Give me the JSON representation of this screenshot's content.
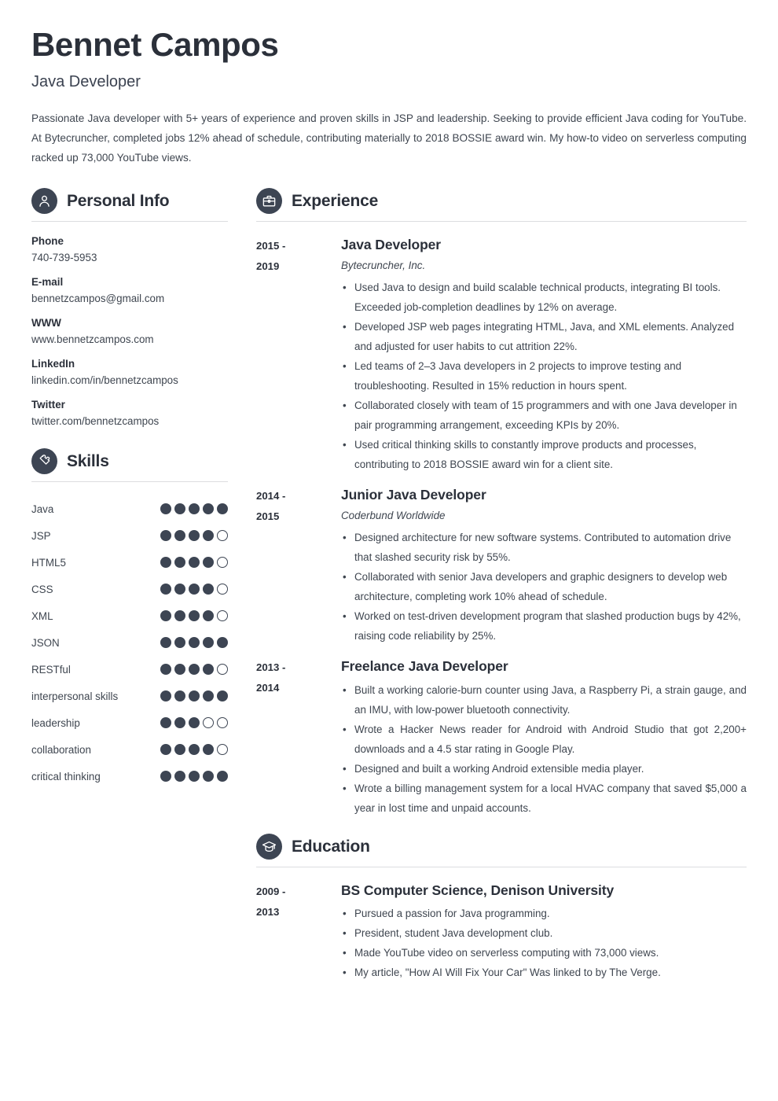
{
  "header": {
    "name": "Bennet Campos",
    "job_title": "Java Developer",
    "summary": "Passionate Java developer with 5+ years of experience and proven skills in JSP and leadership. Seeking to provide efficient Java coding for YouTube. At Bytecruncher, completed jobs 12% ahead of schedule, contributing materially to 2018 BOSSIE award win. My how-to video on serverless computing racked up 73,000 YouTube views."
  },
  "theme": {
    "accent": "#3d4553",
    "heading": "#2b303a",
    "text": "#3f4650",
    "rule": "#dcdde0",
    "background": "#ffffff"
  },
  "personal_info": {
    "section_title": "Personal Info",
    "icon": "user-icon",
    "items": [
      {
        "label": "Phone",
        "value": "740-739-5953"
      },
      {
        "label": "E-mail",
        "value": "bennetzcampos@gmail.com"
      },
      {
        "label": "WWW",
        "value": "www.bennetzcampos.com"
      },
      {
        "label": "LinkedIn",
        "value": "linkedin.com/in/bennetzcampos"
      },
      {
        "label": "Twitter",
        "value": "twitter.com/bennetzcampos"
      }
    ]
  },
  "skills": {
    "section_title": "Skills",
    "icon": "puzzle-piece-icon",
    "max_rating": 5,
    "items": [
      {
        "name": "Java",
        "rating": 5
      },
      {
        "name": "JSP",
        "rating": 4
      },
      {
        "name": "HTML5",
        "rating": 4
      },
      {
        "name": "CSS",
        "rating": 4
      },
      {
        "name": "XML",
        "rating": 4
      },
      {
        "name": "JSON",
        "rating": 5
      },
      {
        "name": "RESTful",
        "rating": 4
      },
      {
        "name": "interpersonal skills",
        "rating": 5
      },
      {
        "name": "leadership",
        "rating": 3
      },
      {
        "name": "collaboration",
        "rating": 4
      },
      {
        "name": "critical thinking",
        "rating": 5
      }
    ]
  },
  "experience": {
    "section_title": "Experience",
    "icon": "briefcase-icon",
    "entries": [
      {
        "date_start": "2015 -",
        "date_end": "2019",
        "title": "Java Developer",
        "org": "Bytecruncher, Inc.",
        "bullets": [
          "Used Java to design and build scalable technical products, integrating BI tools. Exceeded job-completion deadlines by 12% on average.",
          "Developed JSP web pages integrating HTML, Java, and XML elements. Analyzed and adjusted for user habits to cut attrition 22%.",
          "Led teams of 2–3 Java developers in 2 projects to improve testing and troubleshooting. Resulted in 15% reduction in hours spent.",
          "Collaborated closely with team of 15 programmers and with one Java developer in pair programming arrangement, exceeding KPIs by 20%.",
          "Used critical thinking skills to constantly improve products and processes, contributing to 2018 BOSSIE award win for a client site."
        ]
      },
      {
        "date_start": "2014 -",
        "date_end": "2015",
        "title": "Junior Java Developer",
        "org": "Coderbund Worldwide",
        "bullets": [
          "Designed architecture for new software systems. Contributed to automation drive that slashed security risk by 55%.",
          "Collaborated with senior Java developers and graphic designers to develop web architecture, completing work 10% ahead of schedule.",
          "Worked on test-driven development program that slashed production bugs by 42%, raising code reliability by 25%."
        ]
      },
      {
        "date_start": "2013 -",
        "date_end": "2014",
        "title": "Freelance Java Developer",
        "org": "",
        "bullets": [
          "Built a working calorie-burn counter using Java, a Raspberry Pi, a strain gauge, and an IMU, with low-power bluetooth connectivity.",
          "Wrote a Hacker News reader for Android with Android Studio that got 2,200+ downloads and a 4.5 star rating in Google Play.",
          "Designed and built a working Android extensible media player.",
          "Wrote a billing management system for a local HVAC company that saved $5,000 a year in lost time and unpaid accounts."
        ]
      }
    ]
  },
  "education": {
    "section_title": "Education",
    "icon": "graduation-cap-icon",
    "entries": [
      {
        "date_start": "2009 -",
        "date_end": "2013",
        "title": "BS Computer Science, Denison University",
        "org": "",
        "bullets": [
          "Pursued a passion for Java programming.",
          "President, student Java development club.",
          "Made YouTube video on serverless computing with 73,000 views.",
          "My article, \"How AI Will Fix Your Car\" Was linked to by The Verge."
        ]
      }
    ]
  }
}
